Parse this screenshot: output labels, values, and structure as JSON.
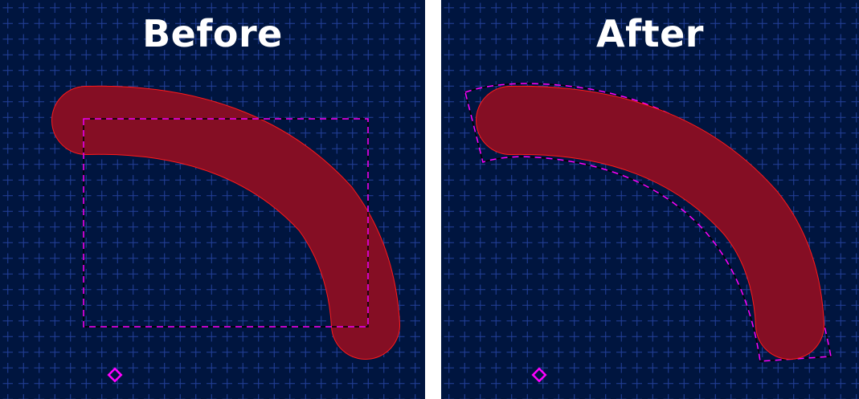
{
  "panels": {
    "before": {
      "title": "Before"
    },
    "after": {
      "title": "After"
    }
  },
  "colors": {
    "background": "#00153f",
    "grid": "#1f3b86",
    "track_fill": "#850e24",
    "track_outline": "#ff1a1a",
    "selection_dash": "#ff00ff",
    "anchor_marker": "#ff00ff",
    "divider": "#ffffff"
  },
  "icons": {
    "anchor": "diamond-icon"
  }
}
